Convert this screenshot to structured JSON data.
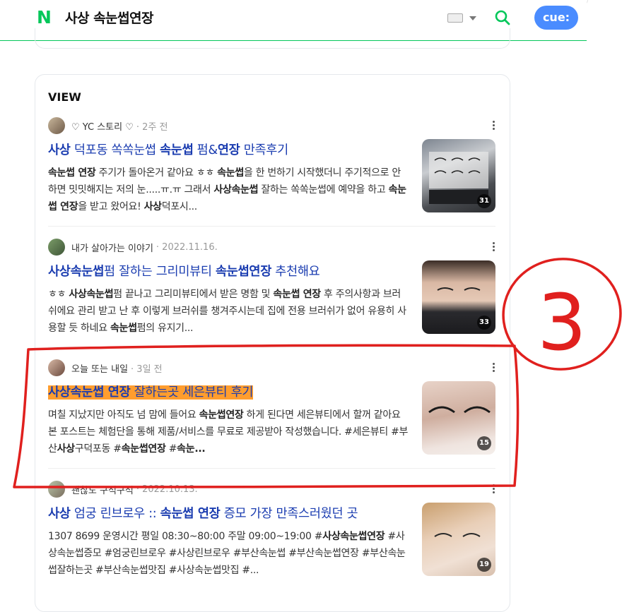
{
  "header": {
    "logo": "N",
    "query": "사상 속눈썹연장",
    "cue_label": "cue:"
  },
  "section": {
    "title": "VIEW"
  },
  "posts": [
    {
      "author": "♡ YC 스토리 ♡",
      "date": "· 2주 전",
      "title_parts": [
        {
          "t": "사상",
          "b": true
        },
        {
          "t": " 덕포동 쏙쏙눈썹 ",
          "b": false
        },
        {
          "t": "속눈썹",
          "b": true
        },
        {
          "t": " 펌&",
          "b": false
        },
        {
          "t": "연장",
          "b": true
        },
        {
          "t": " 만족후기",
          "b": false
        }
      ],
      "desc_parts": [
        {
          "t": "속눈썹 연장",
          "b": true
        },
        {
          "t": " 주기가 돌아온거 같아요 ㅎㅎ ",
          "b": false
        },
        {
          "t": "속눈썹",
          "b": true
        },
        {
          "t": "을 한 번하기 시작했더니 주기적으로 안하면 밋밋해지는 저의 눈.....ㅠ.ㅠ 그래서 ",
          "b": false
        },
        {
          "t": "사상속눈썹",
          "b": true
        },
        {
          "t": " 잘하는 쏙쏙눈썹에 예약을 하고 ",
          "b": false
        },
        {
          "t": "속눈썹 연장",
          "b": true
        },
        {
          "t": "을 받고 왔어요! ",
          "b": false
        },
        {
          "t": "사상",
          "b": true
        },
        {
          "t": "덕포시...",
          "b": false
        }
      ],
      "thumb_count": "31"
    },
    {
      "author": "내가 살아가는 이야기",
      "date": "· 2022.11.16.",
      "title_parts": [
        {
          "t": "사상속눈썹",
          "b": true
        },
        {
          "t": "펌 잘하는 그리미뷰티 ",
          "b": false
        },
        {
          "t": "속눈썹연장",
          "b": true
        },
        {
          "t": " 추천해요",
          "b": false
        }
      ],
      "desc_parts": [
        {
          "t": "ㅎㅎ ",
          "b": false
        },
        {
          "t": "사상속눈썹",
          "b": true
        },
        {
          "t": "펌 끝나고 그리미뷰티에서 받은 명함 및 ",
          "b": false
        },
        {
          "t": "속눈썹 연장",
          "b": true
        },
        {
          "t": " 후 주의사항과 브러쉬에요 관리 받고 난 후 이렇게 브러쉬를 챙겨주시는데 집에 전용 브러쉬가 없어 유용히 사용할 듯 하네요 ",
          "b": false
        },
        {
          "t": "속눈썹",
          "b": true
        },
        {
          "t": "펌의 유지기...",
          "b": false
        }
      ],
      "thumb_count": "33"
    },
    {
      "author": "오늘 또는 내일",
      "date": "· 3일 전",
      "title_parts": [
        {
          "t": "사상속눈썹 연장",
          "b": true
        },
        {
          "t": " 잘하는곳 세은뷰티 후기",
          "b": false
        }
      ],
      "desc_parts": [
        {
          "t": "며칠 지났지만 아직도 넘 맘에 들어요 ",
          "b": false
        },
        {
          "t": "속눈썹연장",
          "b": true
        },
        {
          "t": " 하게 된다면 세은뷰티에서 할꺼 같아요 본 포스트는 체험단을 통해 제품/서비스를 무료로 제공받아 작성했습니다. #세은뷰티 #부산",
          "b": false
        },
        {
          "t": "사상",
          "b": true
        },
        {
          "t": "구덕포동 #",
          "b": false
        },
        {
          "t": "속눈썹연장",
          "b": true
        },
        {
          "t": " #",
          "b": false
        },
        {
          "t": "속눈...",
          "b": true
        }
      ],
      "thumb_count": "15"
    },
    {
      "author": "괜찮도 구석구석",
      "date": "· 2022.10.13.",
      "title_parts": [
        {
          "t": "사상",
          "b": true
        },
        {
          "t": " 엄궁 린브로우 :: ",
          "b": false
        },
        {
          "t": "속눈썹 연장",
          "b": true
        },
        {
          "t": " 증모 가장 만족스러웠던 곳",
          "b": false
        }
      ],
      "desc_parts": [
        {
          "t": "1307 8699 운영시간 평일 08:30~80:00 주말 09:00~19:00 #",
          "b": false
        },
        {
          "t": "사상속눈썹연장",
          "b": true
        },
        {
          "t": " #사상속눈썹증모 #엄궁린브로우 #사상린브로우 #부산속눈썹 #부산속눈썹연장 #부산속눈썹잘하는곳 #부산속눈썹맛집 #사상속눈썹맛집 #...",
          "b": false
        }
      ],
      "thumb_count": "19"
    }
  ],
  "annotation": {
    "label": "3",
    "color": "#e0201e"
  }
}
